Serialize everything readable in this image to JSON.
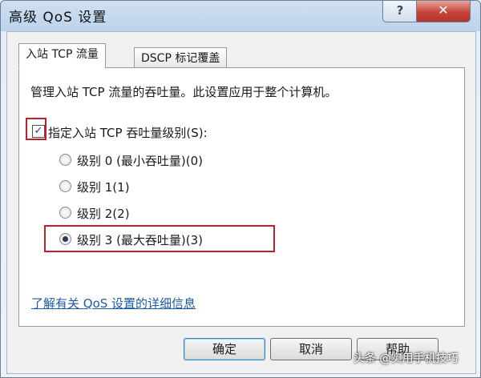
{
  "window": {
    "title": "高级 QoS 设置",
    "help_label": "?",
    "close_label": "✕"
  },
  "tabs": [
    {
      "label": "入站 TCP 流量",
      "active": true
    },
    {
      "label": "DSCP 标记覆盖",
      "active": false
    }
  ],
  "panel": {
    "description": "管理入站 TCP 流量的吞吐量。此设置应用于整个计算机。",
    "checkbox": {
      "label": "指定入站 TCP 吞吐量级别(S):",
      "checked": true,
      "check_glyph": "✓"
    },
    "radios": [
      {
        "label": "级别 0 (最小吞吐量)(0)",
        "checked": false
      },
      {
        "label": "级别 1(1)",
        "checked": false
      },
      {
        "label": "级别 2(2)",
        "checked": false
      },
      {
        "label": "级别 3 (最大吞吐量)(3)",
        "checked": true
      }
    ],
    "link": "了解有关 QoS 设置的详细信息"
  },
  "buttons": {
    "ok": "确定",
    "cancel": "取消",
    "help": "帮助"
  },
  "watermark": "头条 @实用手机技巧",
  "colors": {
    "highlight_box": "#c0202c",
    "link": "#1c5aa6",
    "close_button": "#c7453a"
  }
}
